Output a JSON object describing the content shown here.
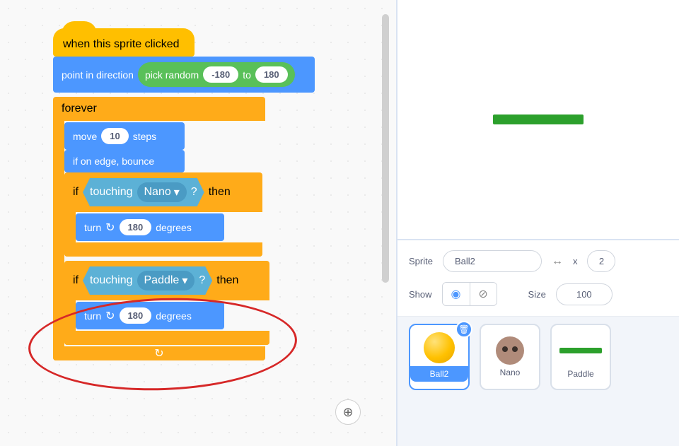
{
  "blocks": {
    "hat": "when this sprite clicked",
    "point_direction": "point in direction",
    "pick_random": "pick random",
    "rand_from": "-180",
    "rand_to_label": "to",
    "rand_to": "180",
    "forever": "forever",
    "move": "move",
    "move_val": "10",
    "steps": "steps",
    "if_on_edge": "if on edge, bounce",
    "if": "if",
    "then": "then",
    "touching": "touching",
    "nano": "Nano",
    "paddle": "Paddle",
    "question": "?",
    "turn": "turn",
    "turn_val1": "180",
    "turn_val2": "180",
    "degrees": "degrees",
    "dropdown_caret": "▾"
  },
  "sprite_info": {
    "sprite_label": "Sprite",
    "sprite_name": "Ball2",
    "x_label": "x",
    "x_val": "2",
    "show_label": "Show",
    "size_label": "Size",
    "size_val": "100"
  },
  "sprites": {
    "ball2": "Ball2",
    "nano": "Nano",
    "paddle": "Paddle"
  },
  "icons": {
    "double_arrow": "↔",
    "zoom": "⊕",
    "eye": "◉",
    "eye_off": "⊘",
    "trash": "🗑",
    "rotate_cw": "↻"
  }
}
